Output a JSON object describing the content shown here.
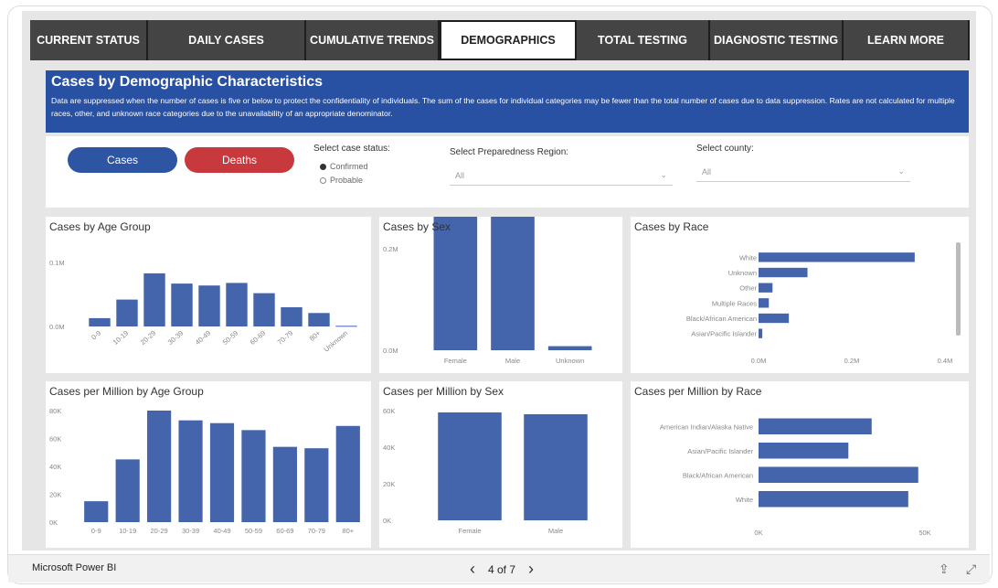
{
  "tabs": [
    "CURRENT STATUS",
    "DAILY CASES",
    "CUMULATIVE TRENDS",
    "DEMOGRAPHICS",
    "TOTAL TESTING",
    "DIAGNOSTIC TESTING",
    "LEARN MORE"
  ],
  "active_tab": "DEMOGRAPHICS",
  "banner": {
    "title": "Cases by Demographic Characteristics",
    "text": "Data are suppressed when the number of cases is five or below to protect the confidentiality of individuals. The sum of the cases for individual categories may be fewer than the total number of cases due to data suppression.  Rates are not calculated for multiple races, other, and unknown race categories due to the unavailability of an appropriate denominator."
  },
  "filters": {
    "cases_button": "Cases",
    "deaths_button": "Deaths",
    "case_status_label": "Select case status:",
    "case_status_options": [
      "Confirmed",
      "Probable"
    ],
    "region_label": "Select Preparedness Region:",
    "region_value": "All",
    "county_label": "Select county:",
    "county_value": "All"
  },
  "colors": {
    "bar": "#4464ac",
    "banner": "#2850a3",
    "cases_pill": "#2e55a4",
    "deaths_pill": "#c8393d"
  },
  "bottom": {
    "brand": "Microsoft Power BI",
    "page": "4 of 7"
  },
  "chart_data": [
    {
      "id": "age",
      "title": "Cases by Age Group",
      "type": "bar",
      "categories": [
        "0-9",
        "10-19",
        "20-29",
        "30-39",
        "40-49",
        "50-59",
        "60-69",
        "70-79",
        "80+",
        "Unknown"
      ],
      "values": [
        0.013,
        0.042,
        0.083,
        0.067,
        0.064,
        0.068,
        0.052,
        0.03,
        0.021,
        0.001
      ],
      "yticks": [
        "0.0M",
        "0.1M"
      ],
      "ylim": [
        0,
        0.1
      ]
    },
    {
      "id": "sex",
      "title": "Cases by Sex",
      "type": "bar",
      "categories": [
        "Female",
        "Male",
        "Unknown"
      ],
      "values": [
        0.285,
        0.27,
        0.008
      ],
      "yticks": [
        "0.0M",
        "0.2M"
      ],
      "ylim": [
        0,
        0.2
      ]
    },
    {
      "id": "race",
      "title": "Cases by Race",
      "type": "bar",
      "orientation": "horizontal",
      "categories": [
        "White",
        "Unknown",
        "Other",
        "Multiple Races",
        "Black/African American",
        "Asian/Pacific Islander"
      ],
      "values": [
        0.335,
        0.105,
        0.03,
        0.022,
        0.065,
        0.008
      ],
      "xticks": [
        "0.0M",
        "0.2M",
        "0.4M"
      ],
      "xlim": [
        0,
        0.4
      ]
    },
    {
      "id": "age_pm",
      "title": "Cases per Million by Age Group",
      "type": "bar",
      "categories": [
        "0-9",
        "10-19",
        "20-29",
        "30-39",
        "40-49",
        "50-59",
        "60-69",
        "70-79",
        "80+"
      ],
      "values": [
        15000,
        45000,
        80000,
        73000,
        71000,
        66000,
        54000,
        53000,
        69000
      ],
      "yticks": [
        "0K",
        "20K",
        "40K",
        "60K",
        "80K"
      ],
      "ylim": [
        0,
        80000
      ]
    },
    {
      "id": "sex_pm",
      "title": "Cases per Million by Sex",
      "type": "bar",
      "categories": [
        "Female",
        "Male"
      ],
      "values": [
        59000,
        58000
      ],
      "yticks": [
        "0K",
        "20K",
        "40K",
        "60K"
      ],
      "ylim": [
        0,
        60000
      ]
    },
    {
      "id": "race_pm",
      "title": "Cases per Million by Race",
      "type": "bar",
      "orientation": "horizontal",
      "categories": [
        "American Indian/Alaska Native",
        "Asian/Pacific Islander",
        "Black/African American",
        "White"
      ],
      "values": [
        34000,
        27000,
        48000,
        45000
      ],
      "xticks": [
        "0K",
        "50K"
      ],
      "xlim": [
        0,
        50000
      ]
    }
  ]
}
